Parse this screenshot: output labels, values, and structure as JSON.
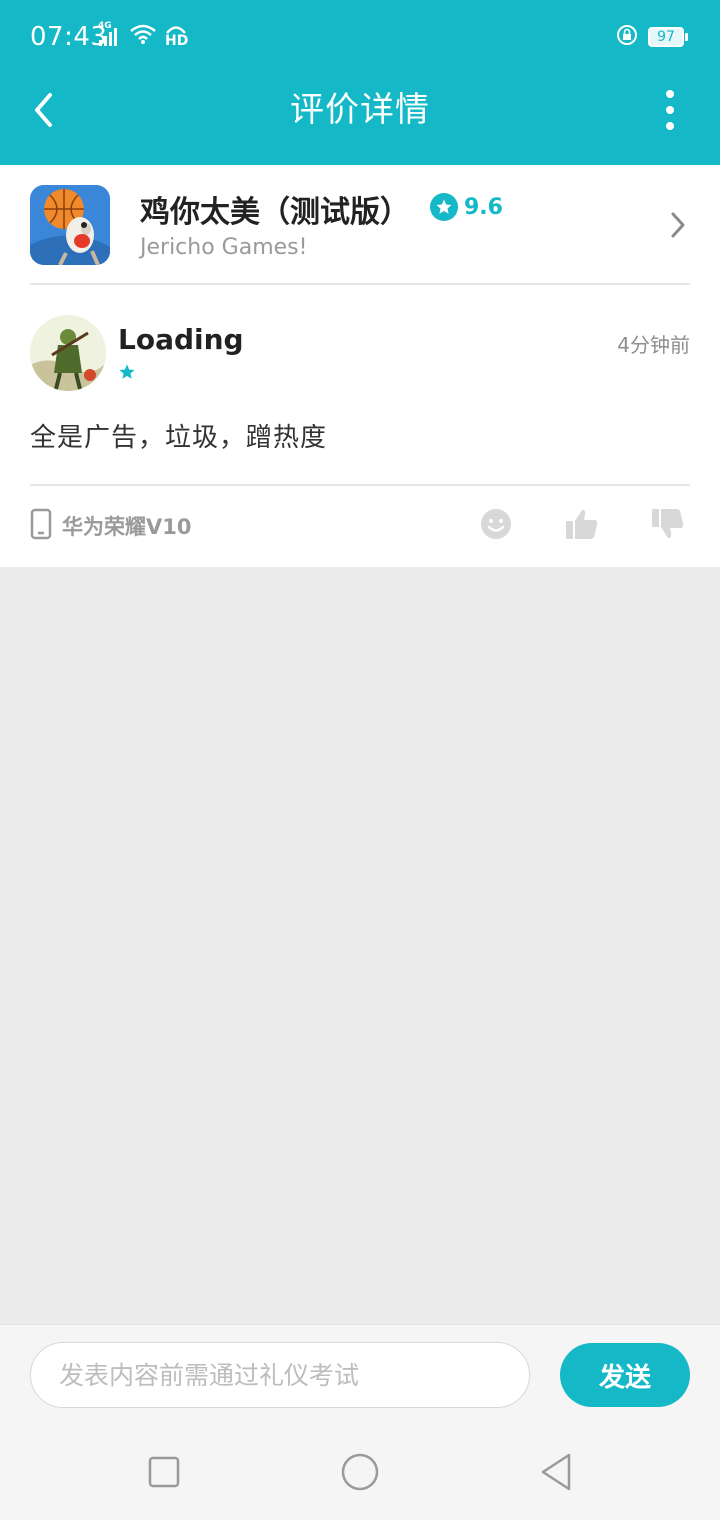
{
  "status_bar": {
    "time": "07:43",
    "network": "4G",
    "hd": "HD",
    "battery": "97"
  },
  "nav": {
    "title": "评价详情"
  },
  "game": {
    "name": "鸡你太美（测试版）",
    "rating": "9.6",
    "developer": "Jericho Games!"
  },
  "review": {
    "username": "Loading",
    "stars": 1,
    "time_ago": "4分钟前",
    "text": "全是广告，垃圾，蹭热度",
    "device": "华为荣耀V10"
  },
  "comment": {
    "placeholder": "发表内容前需通过礼仪考试",
    "send_label": "发送"
  },
  "colors": {
    "accent": "#14b8c7",
    "page_bg": "#ececec"
  }
}
